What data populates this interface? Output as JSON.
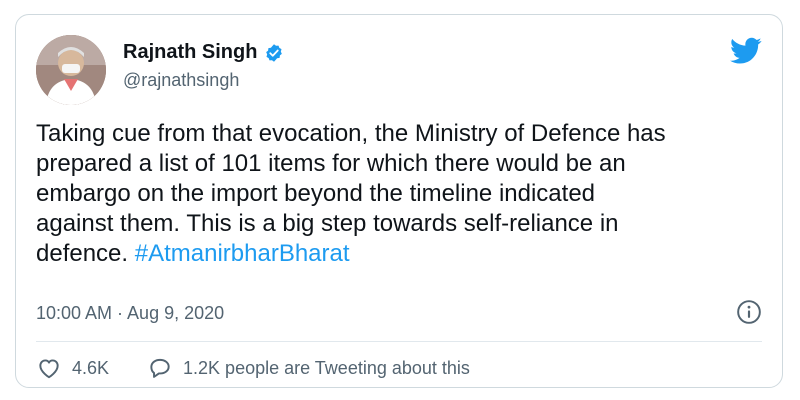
{
  "author": {
    "name": "Rajnath Singh",
    "handle": "@rajnathsingh"
  },
  "tweet": {
    "text": "Taking cue from that evocation, the Ministry of Defence has\nprepared a list of 101 items for which there would be an\nembargo on the import beyond the timeline indicated\nagainst them. This is a big step towards self-reliance in\ndefence. ",
    "hashtag": "#AtmanirbharBharat"
  },
  "meta": {
    "timestamp": "10:00 AM · Aug 9, 2020"
  },
  "actions": {
    "likes": "4.6K",
    "conversation": "1.2K people are Tweeting about this"
  },
  "icons": {
    "verified": "verified-badge-icon",
    "brand": "twitter-bird-icon",
    "info": "info-icon",
    "like": "heart-icon",
    "reply": "speech-bubble-icon"
  },
  "colors": {
    "accent": "#1d9bf0",
    "text": "#0f1419",
    "secondary": "#536471",
    "border": "#cfd9de"
  }
}
